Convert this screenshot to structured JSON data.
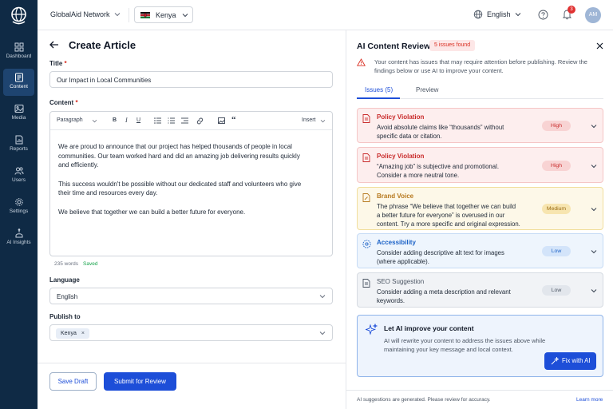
{
  "sidebar": {
    "items": [
      {
        "label": "Dashboard",
        "icon": "grid-icon"
      },
      {
        "label": "Content",
        "icon": "document-icon",
        "active": true
      },
      {
        "label": "Media",
        "icon": "image-icon"
      },
      {
        "label": "Reports",
        "icon": "report-icon"
      },
      {
        "label": "Users",
        "icon": "users-icon"
      },
      {
        "label": "Settings",
        "icon": "gear-icon"
      },
      {
        "label": "AI Insights",
        "icon": "ai-insights-icon"
      }
    ]
  },
  "topbar": {
    "org_name": "GlobalAid Network",
    "country": "Kenya",
    "language": "English",
    "notifications": "3",
    "avatar_initials": "AM"
  },
  "form": {
    "page_title": "Create Article",
    "title_label": "Title",
    "title_value": "Our Impact in Local Communities",
    "content_label": "Content",
    "toolbar": {
      "paragraph": "Paragraph",
      "bold": "B",
      "italic": "I",
      "underline": "U",
      "insert": "Insert"
    },
    "paragraphs": [
      "We are proud to announce that our project has helped thousands of people in local communities. Our team worked hard and did an amazing job delivering results quickly and efficiently.",
      "This success wouldn't be possible without our dedicated staff and volunteers who give their time and resources every day.",
      "We believe that together we can build a better future for everyone."
    ],
    "word_count": "235 words",
    "saved": "Saved",
    "language_label": "Language",
    "language_value": "English",
    "publish_label": "Publish to",
    "publish_tag": "Kenya",
    "save_draft": "Save Draft",
    "submit": "Submit for Review"
  },
  "review": {
    "title": "AI Content Review",
    "badge": "5 issues found",
    "warning": "Your content has issues that may require attention before publishing. Review the findings below or use AI to improve your content.",
    "tabs": [
      "Issues (5)",
      "Preview"
    ],
    "issues": [
      {
        "title": "Policy Violation",
        "desc": "Avoid absolute claims like “thousands” without specific data or citation.",
        "severity": "High"
      },
      {
        "title": "Policy Violation",
        "desc": "“Amazing job” is subjective and promotional. Consider a more neutral tone.",
        "severity": "High"
      },
      {
        "title": "Brand Voice",
        "desc": "The phrase “We believe that together we can build a better future for everyone” is overused in our content. Try a more specific and original expression.",
        "severity": "Medium"
      },
      {
        "title": "Accessibility",
        "desc": "Consider adding descriptive alt text for images (where applicable).",
        "severity": "Low"
      },
      {
        "title": "SEO Suggestion",
        "desc": "Consider adding a meta description and relevant keywords.",
        "severity": "Low"
      }
    ],
    "ai": {
      "title": "Let AI improve your content",
      "desc": "AI will rewrite your content to address the issues above while maintaining your key message and local context.",
      "button": "Fix with AI"
    },
    "disclaimer": "AI suggestions are generated. Please review for accuracy.",
    "learn_more": "Learn more"
  },
  "colors": {
    "sidebar": "#0f2a45",
    "primary": "#1d4ed8",
    "high": "#c92a2a",
    "medium": "#b7791f",
    "low": "#1d63c7"
  }
}
